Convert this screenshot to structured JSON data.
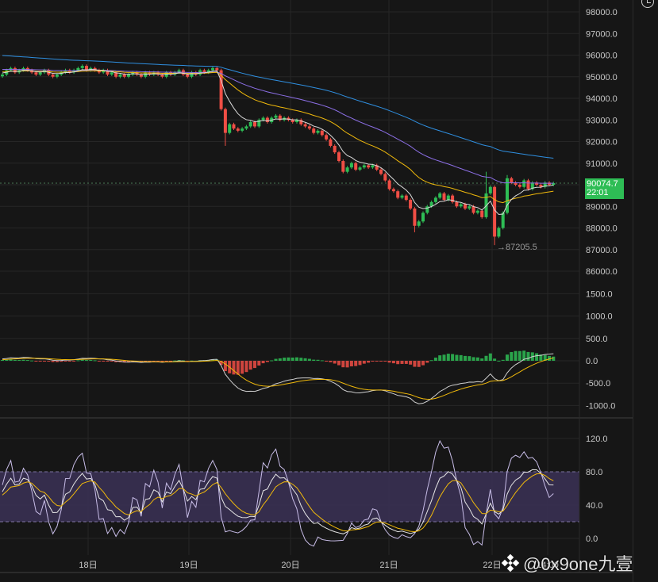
{
  "chart_data": {
    "type": "candlestick",
    "title": "",
    "price_axis": {
      "ticks": [
        "98000.0",
        "97000.0",
        "96000.0",
        "95000.0",
        "94000.0",
        "93000.0",
        "92000.0",
        "91000.0",
        "90000.0",
        "89000.0",
        "88000.0",
        "87000.0",
        "86000.0"
      ],
      "range": [
        86000,
        98000
      ]
    },
    "macd_axis": {
      "ticks": [
        "1500.0",
        "1000.0",
        "500.0",
        "0.0",
        "-500.0",
        "-1000.0"
      ],
      "range": [
        -1000,
        1500
      ]
    },
    "kdj_axis": {
      "ticks": [
        "120.0",
        "80.0",
        "40.0",
        "0.0"
      ],
      "range": [
        0,
        120
      ],
      "band": [
        20,
        80
      ]
    },
    "time_axis": {
      "ticks": [
        "18日",
        "19日",
        "20日",
        "21日",
        "22日",
        "14:00"
      ]
    },
    "closes": [
      95100,
      95300,
      95400,
      95200,
      95300,
      95400,
      95300,
      95200,
      95100,
      95200,
      95300,
      95100,
      95000,
      95100,
      95200,
      95300,
      95200,
      95300,
      95400,
      95500,
      95300,
      95400,
      95300,
      95200,
      95300,
      95100,
      95200,
      95000,
      95100,
      95000,
      95100,
      95200,
      95100,
      95000,
      95200,
      95100,
      95200,
      95100,
      95000,
      95200,
      95100,
      95200,
      95300,
      95100,
      95000,
      95200,
      95100,
      95300,
      95200,
      95300,
      95400,
      95300,
      93500,
      92400,
      92800,
      92600,
      92500,
      92600,
      92700,
      92900,
      92700,
      93000,
      93100,
      92900,
      93100,
      93200,
      93000,
      93100,
      93000,
      92900,
      93000,
      92800,
      92700,
      92600,
      92400,
      92500,
      92300,
      92100,
      91800,
      91500,
      91100,
      90600,
      90800,
      91000,
      90700,
      90800,
      90900,
      90800,
      90900,
      90700,
      90500,
      90200,
      89800,
      89700,
      89400,
      89500,
      89300,
      88900,
      88100,
      88300,
      88700,
      89000,
      89200,
      89400,
      89600,
      89300,
      89500,
      89200,
      89000,
      89100,
      88900,
      89000,
      88700,
      88800,
      88500,
      89600,
      89900,
      87600,
      88000,
      88700,
      90300,
      90100,
      90000,
      89900,
      90200,
      89800,
      90100,
      90000,
      89900,
      90100,
      90000,
      90074.7
    ],
    "wick_overrides": {
      "53": {
        "low": 91800
      },
      "98": {
        "low": 87800
      },
      "115": {
        "high": 90600
      },
      "117": {
        "low": 87205.5
      },
      "120": {
        "high": 90450
      }
    },
    "last_price": "90074.7",
    "countdown": "22:01",
    "low_annotation": "→87205.5",
    "colors": {
      "up": "#2ebd55",
      "down": "#f04e45",
      "ma_fast": "#d9d9d9",
      "ma_mid": "#f0b90b",
      "ma_slow": "#8c6fe6",
      "ma_long": "#2f8fe0",
      "kdj_k": "#e6e6e6",
      "kdj_d": "#f0b90b",
      "kdj_j": "#c8bde8",
      "band": "#3b3156"
    }
  },
  "watermark": {
    "text": "@0x9one九壹",
    "logo": "binance-logo"
  },
  "toolbar": {
    "icon": "clock-icon"
  }
}
